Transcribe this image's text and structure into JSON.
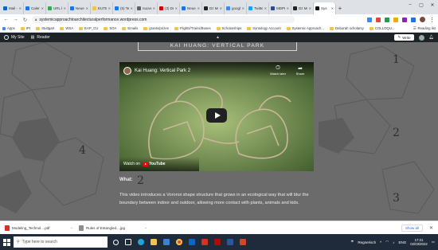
{
  "browser": {
    "tabs": [
      {
        "label": "Mail -",
        "color": "#0a66c2"
      },
      {
        "label": "Calend",
        "color": "#1a73e8"
      },
      {
        "label": "URL bl",
        "color": "#34a853"
      },
      {
        "label": "Neuer",
        "color": "#1a73e8"
      },
      {
        "label": "EUTEX",
        "color": "#f2c14e"
      },
      {
        "label": "(5) Te",
        "color": "#1877f2"
      },
      {
        "label": "nuove",
        "color": "#5f6368"
      },
      {
        "label": "(3) Dr",
        "color": "#c00"
      },
      {
        "label": "Neues",
        "color": "#1a73e8"
      },
      {
        "label": "Dz Mo",
        "color": "#222"
      },
      {
        "label": "googl",
        "color": "#4285f4"
      },
      {
        "label": "Twitter",
        "color": "#1da1f2"
      },
      {
        "label": "MDPI",
        "color": "#2b4a8b"
      },
      {
        "label": "Dz Mo",
        "color": "#222"
      },
      {
        "label": "Sys",
        "color": "#111"
      }
    ],
    "new_tab": "+",
    "url": "systemicapproachtoarchitecturalperformance.wordpress.com",
    "extension_colors": [
      "#4285f4",
      "#e0463a",
      "#1f9d55",
      "#f2a900",
      "#8e24aa",
      "#1a73e8"
    ]
  },
  "bookmarks": {
    "items": [
      "Apps",
      "IPI",
      "Stuttgart",
      "WSA",
      "EAP_CU",
      "SOA",
      "Emails",
      "grants/prizes",
      "Flights/Trains/Buses",
      "Scholarships",
      "Syntology Account",
      "Systemic Approach...",
      "Deborah scholarsy",
      "COLLOQU..."
    ],
    "reading_list": "Reading list"
  },
  "wp": {
    "my_site": "My Site",
    "reader": "Reader",
    "write": "Write"
  },
  "page": {
    "title": "KAI HUANG: VERTICAL PARK",
    "numbers": [
      "1",
      "2",
      "3",
      "4",
      "2"
    ],
    "video": {
      "title": "Kai Huang: Vertical Park 2",
      "watch_later": "Watch later",
      "share": "Share",
      "watch_on": "Watch on",
      "youtube": "YouTube"
    },
    "what_label": "What:",
    "description": "This video introduces a Voronoi shape structure that grows in an ecological way that will blur the boundary between indoor and outdoor, allowing more contact with plants, animals and kids."
  },
  "downloads": {
    "items": [
      "Modeling_Technol....pdf",
      "Rules of Entangled....jpg"
    ],
    "show_all": "Show all"
  },
  "taskbar": {
    "search_placeholder": "Type here to search",
    "weather": "Regnerisch",
    "lang": "ENG",
    "time": "17:21",
    "date": "02/03/2022"
  }
}
